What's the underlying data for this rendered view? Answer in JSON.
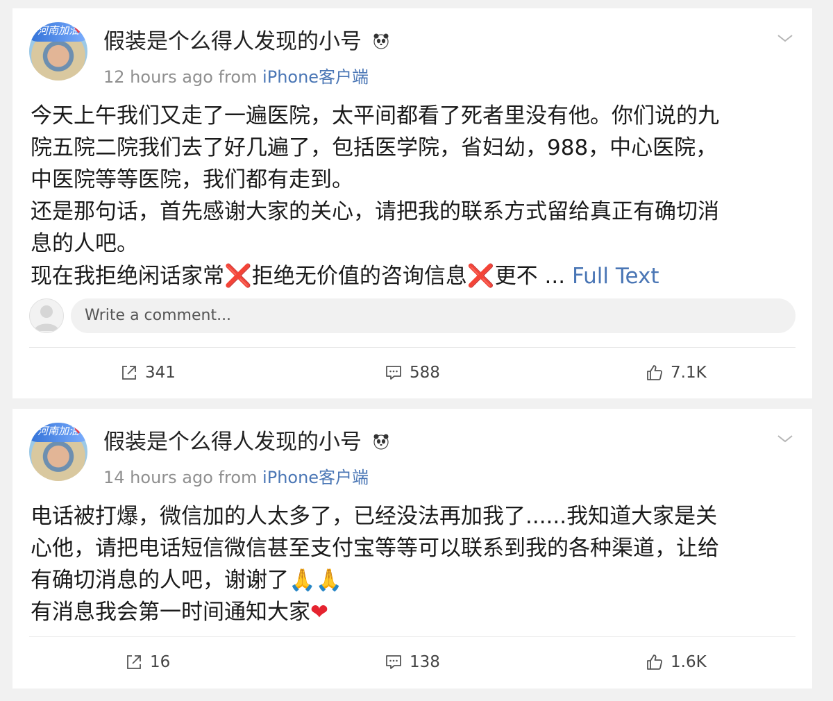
{
  "posts": [
    {
      "username": "假装是个么得人发现的小号",
      "avatar_badge": "河南加油",
      "time": "12 hours ago",
      "from_label": "from",
      "source": "iPhone客户端",
      "lines": [
        "今天上午我们又走了一遍医院，太平间都看了死者里没有他。你们说的九",
        "院五院二院我们去了好几遍了，包括医学院，省妇幼，988，中心医院，",
        "中医院等等医院，我们都有走到。",
        "还是那句话，首先感谢大家的关心，请把我的联系方式留给真正有确切消",
        "息的人吧。"
      ],
      "last_line_a": "现在我拒绝闲话家常",
      "emoji_x": "❌",
      "last_line_b": "拒绝无价值的咨询信息",
      "last_line_c": "更不 ... ",
      "full_text_label": "Full Text",
      "comment_placeholder": "Write a comment...",
      "reposts": "341",
      "comments": "588",
      "likes": "7.1K"
    },
    {
      "username": "假装是个么得人发现的小号",
      "avatar_badge": "河南加油",
      "time": "14 hours ago",
      "from_label": "from",
      "source": "iPhone客户端",
      "lines": [
        "电话被打爆，微信加的人太多了，已经没法再加我了......我知道大家是关",
        "心他，请把电话短信微信甚至支付宝等等可以联系到我的各种渠道，让给"
      ],
      "line3": "有确切消息的人吧，谢谢了",
      "emoji_hands": "🙏🙏",
      "line4": "有消息我会第一时间通知大家",
      "emoji_heart": "❤",
      "reposts": "16",
      "comments": "138",
      "likes": "1.6K"
    }
  ],
  "icons": {
    "panda": "panda-icon",
    "chevron": "chevron-down-icon",
    "repost": "repost-icon",
    "comment": "comment-icon",
    "like": "thumbs-up-icon"
  },
  "colors": {
    "link": "#4a76b5",
    "meta_gray": "#8f8f8f",
    "background": "#f1f1f1",
    "card": "#ffffff"
  }
}
